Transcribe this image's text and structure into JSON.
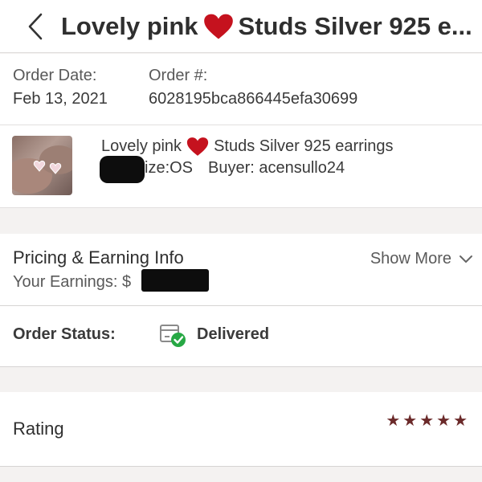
{
  "header": {
    "title_part1": "Lovely pink",
    "title_part2": "Studs Silver 925 e...",
    "heart_icon": "heart-icon",
    "back_icon": "chevron-left-icon"
  },
  "order": {
    "date_label": "Order Date:",
    "date_value": "Feb 13, 2021",
    "number_label": "Order #:",
    "number_value": "6028195bca866445efa30699"
  },
  "item": {
    "title_part1": "Lovely pink",
    "title_part2": "Studs Silver 925 earrings",
    "size_text": "ize:OS",
    "buyer_text": "Buyer: acensullo24"
  },
  "pricing": {
    "title": "Pricing & Earning Info",
    "earnings_label": "Your Earnings: $",
    "show_more": "Show More"
  },
  "status": {
    "label": "Order Status:",
    "value": "Delivered",
    "icon": "delivered-box-icon"
  },
  "rating": {
    "label": "Rating",
    "stars": 5,
    "max_stars": 5
  },
  "colors": {
    "heart": "#c5121e",
    "star": "#6b2a2a",
    "check": "#27a844",
    "background": "#f4f2f1"
  }
}
